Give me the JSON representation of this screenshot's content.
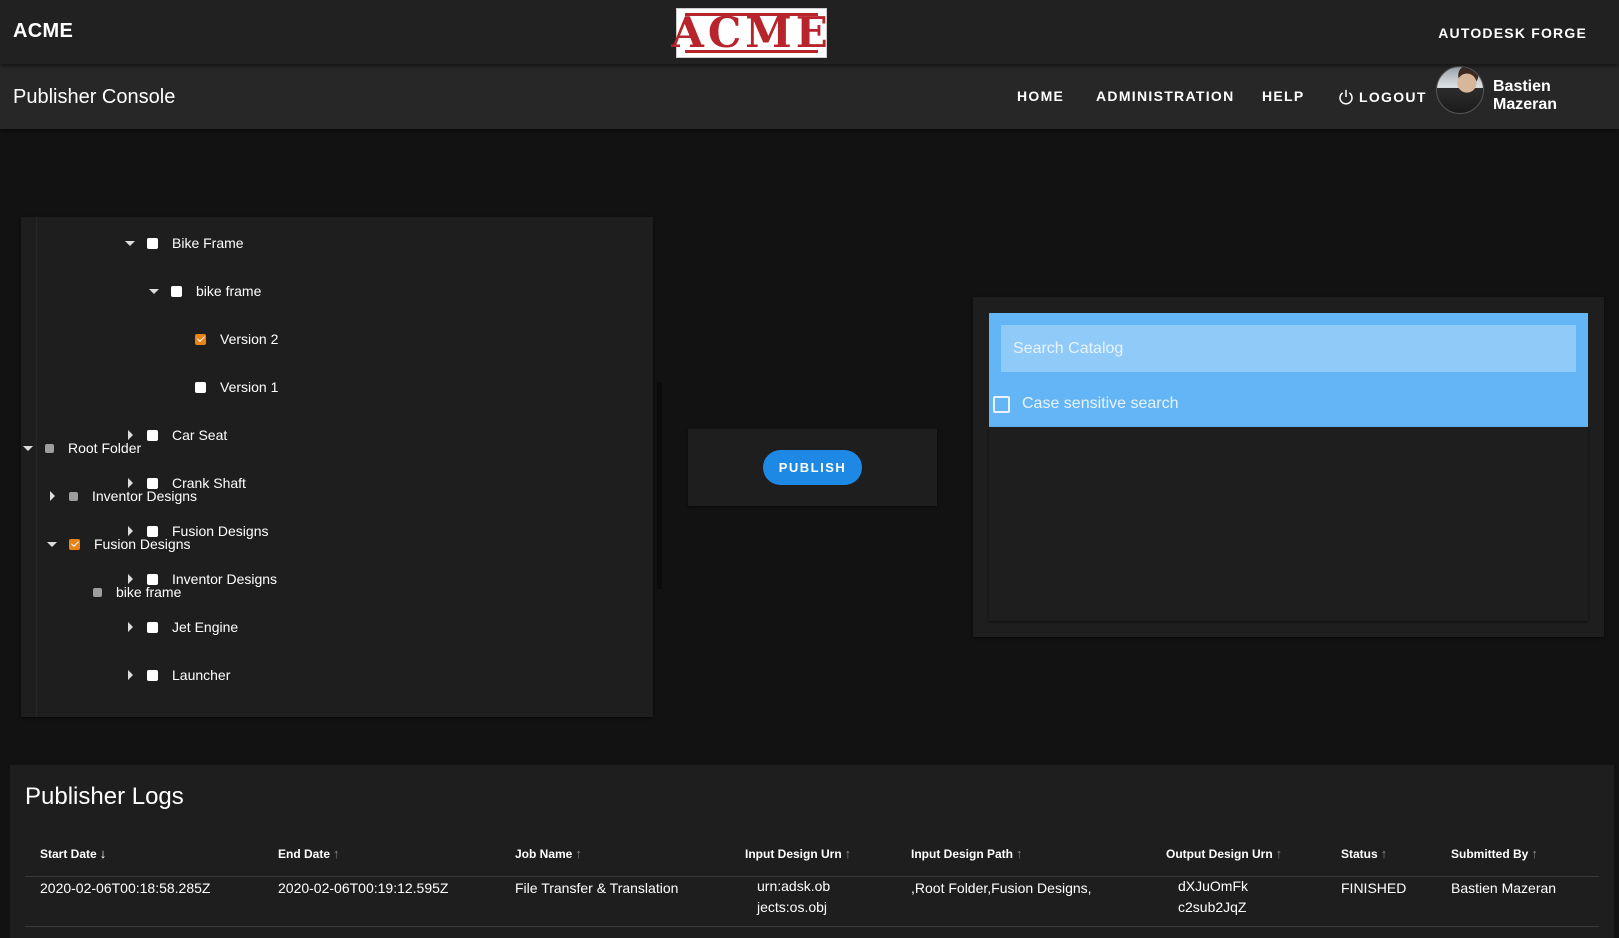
{
  "header": {
    "brand": "ACME",
    "logo_text": "ACME",
    "forge_label": "AUTODESK FORGE"
  },
  "subheader": {
    "title": "Publisher Console",
    "nav": {
      "home": "HOME",
      "administration": "ADMINISTRATION",
      "help": "HELP",
      "logout": "LOGOUT"
    },
    "user_name": "Bastien Mazeran"
  },
  "source_tree": [
    {
      "label": "Bike Frame",
      "state": "expanded",
      "checked": false
    },
    {
      "label": "bike frame",
      "state": "expanded",
      "checked": false
    },
    {
      "label": "Version 2",
      "state": "leaf",
      "checked": true
    },
    {
      "label": "Version 1",
      "state": "leaf",
      "checked": false
    },
    {
      "label": "Car Seat",
      "state": "collapsed",
      "checked": false
    },
    {
      "label": "Crank Shaft",
      "state": "collapsed",
      "checked": false
    },
    {
      "label": "Fusion Designs",
      "state": "collapsed",
      "checked": false
    },
    {
      "label": "Inventor Designs",
      "state": "collapsed",
      "checked": false
    },
    {
      "label": "Jet Engine",
      "state": "collapsed",
      "checked": false
    },
    {
      "label": "Launcher",
      "state": "collapsed",
      "checked": false
    }
  ],
  "publish": {
    "button_label": "PUBLISH"
  },
  "catalog": {
    "search_placeholder": "Search Catalog",
    "case_sensitive_label": "Case sensitive search",
    "tree": [
      {
        "label": "Root Folder",
        "state": "expanded",
        "checked": false
      },
      {
        "label": "Inventor Designs",
        "state": "collapsed",
        "checked": false
      },
      {
        "label": "Fusion Designs",
        "state": "expanded",
        "checked": true
      },
      {
        "label": "bike frame",
        "state": "leaf",
        "checked": false
      }
    ]
  },
  "logs": {
    "title": "Publisher Logs",
    "columns": [
      "Start Date",
      "End Date",
      "Job Name",
      "Input Design Urn",
      "Input Design Path",
      "Output Design Urn",
      "Status",
      "Submitted By"
    ],
    "sort_column": "Start Date",
    "rows": [
      {
        "start_date": "2020-02-06T00:18:58.285Z",
        "end_date": "2020-02-06T00:19:12.595Z",
        "job_name": "File Transfer & Translation",
        "input_urn_line1": "urn:adsk.ob",
        "input_urn_line2": "jects:os.obj",
        "input_path": ",Root Folder,Fusion Designs,",
        "output_urn_line1": "dXJuOmFk",
        "output_urn_line2": "c2sub2JqZ",
        "status": "FINISHED",
        "submitted_by": "Bastien Mazeran"
      }
    ]
  }
}
